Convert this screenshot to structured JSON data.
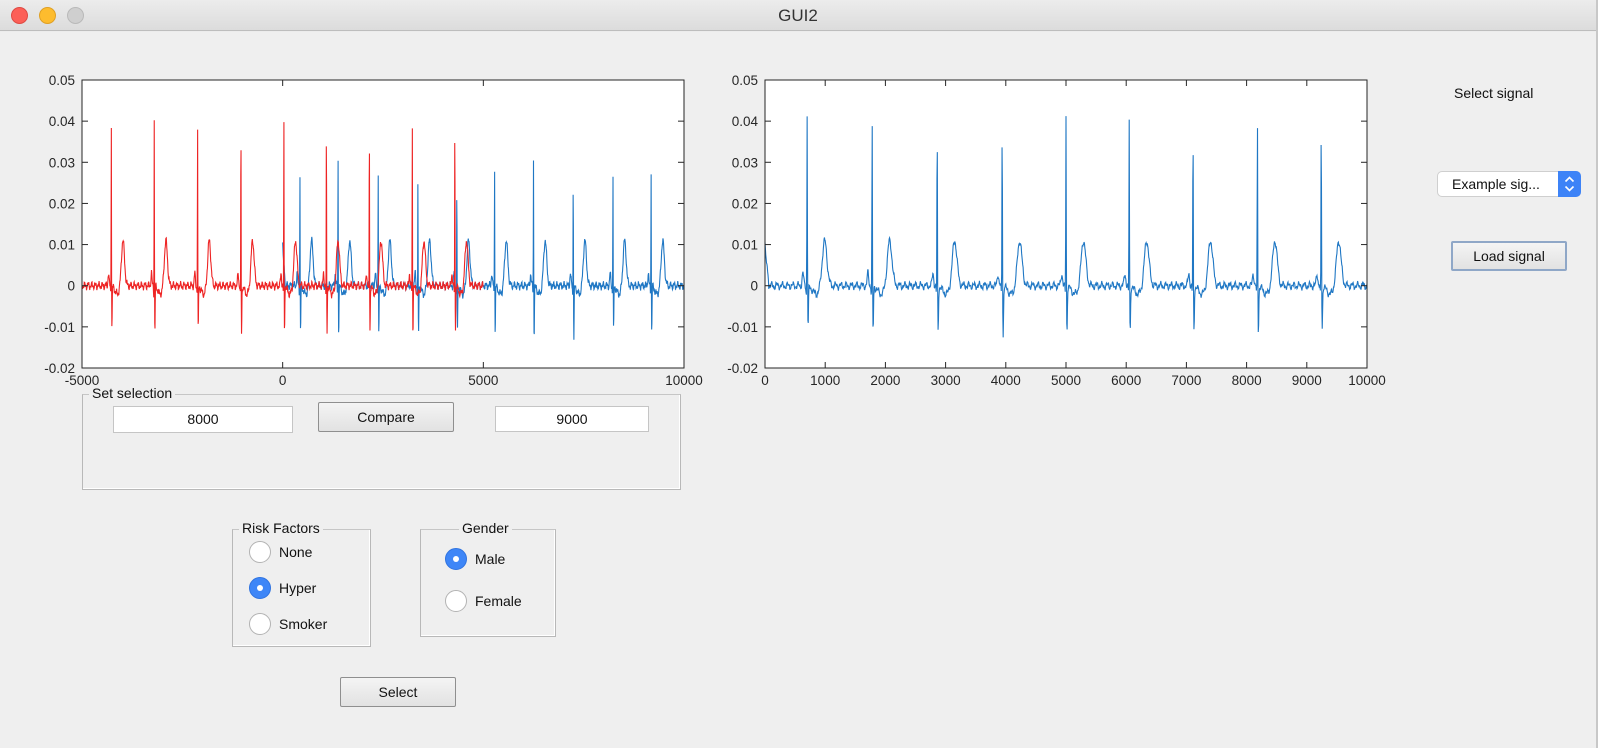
{
  "window": {
    "title": "GUI2"
  },
  "colors": {
    "overlay_series": "#ee2424",
    "signal_series": "#1f77c4",
    "radio_selected": "#3e86f7"
  },
  "select_signal_label": "Select signal",
  "signal_dropdown": {
    "value": "Example sig..."
  },
  "load_button_label": "Load signal",
  "selection_panel": {
    "title": "Set selection",
    "start_value": "8000",
    "end_value": "9000",
    "compare_label": "Compare"
  },
  "risk_factors": {
    "title": "Risk Factors",
    "options": [
      "None",
      "Hyper",
      "Smoker"
    ],
    "selected": "Hyper"
  },
  "gender": {
    "title": "Gender",
    "options": [
      "Male",
      "Female"
    ],
    "selected": "Male"
  },
  "select_button_label": "Select",
  "chart_data": [
    {
      "type": "line",
      "title": "",
      "xlabel": "",
      "ylabel": "",
      "xlim": [
        -5000,
        10000
      ],
      "ylim": [
        -0.02,
        0.05
      ],
      "xticks": [
        "-5000",
        "0",
        "5000",
        "10000"
      ],
      "yticks": [
        "-0.02",
        "-0.01",
        "0",
        "0.01",
        "0.02",
        "0.03",
        "0.04",
        "0.05"
      ],
      "grid": false,
      "series": [
        {
          "color": "#1f77c4",
          "x_range": [
            0,
            10000
          ],
          "beats": [
            {
              "r_peak_x": 430,
              "r_peak_y": 0.029,
              "s_y": -0.011
            },
            {
              "r_peak_x": 1380,
              "r_peak_y": 0.033,
              "s_y": -0.011
            },
            {
              "r_peak_x": 2380,
              "r_peak_y": 0.03,
              "s_y": -0.012
            },
            {
              "r_peak_x": 3370,
              "r_peak_y": 0.026,
              "s_y": -0.012
            },
            {
              "r_peak_x": 4340,
              "r_peak_y": 0.026,
              "s_y": -0.011
            },
            {
              "r_peak_x": 5280,
              "r_peak_y": 0.031,
              "s_y": -0.011
            },
            {
              "r_peak_x": 6250,
              "r_peak_y": 0.031,
              "s_y": -0.012
            },
            {
              "r_peak_x": 7240,
              "r_peak_y": 0.028,
              "s_y": -0.013
            },
            {
              "r_peak_x": 8230,
              "r_peak_y": 0.029,
              "s_y": -0.011
            },
            {
              "r_peak_x": 9180,
              "r_peak_y": 0.03,
              "s_y": -0.011
            }
          ]
        },
        {
          "color": "#ee2424",
          "x_range": [
            -5000,
            5000
          ],
          "beats": [
            {
              "r_peak_x": -4270,
              "r_peak_y": 0.042,
              "s_y": -0.01
            },
            {
              "r_peak_x": -3200,
              "r_peak_y": 0.041,
              "s_y": -0.011
            },
            {
              "r_peak_x": -2120,
              "r_peak_y": 0.041,
              "s_y": -0.011
            },
            {
              "r_peak_x": -1040,
              "r_peak_y": 0.042,
              "s_y": -0.012
            },
            {
              "r_peak_x": 30,
              "r_peak_y": 0.042,
              "s_y": -0.011
            },
            {
              "r_peak_x": 1090,
              "r_peak_y": 0.041,
              "s_y": -0.011
            },
            {
              "r_peak_x": 2160,
              "r_peak_y": 0.041,
              "s_y": -0.011
            },
            {
              "r_peak_x": 3230,
              "r_peak_y": 0.041,
              "s_y": -0.011
            },
            {
              "r_peak_x": 4290,
              "r_peak_y": 0.042,
              "s_y": -0.01
            }
          ]
        }
      ]
    },
    {
      "type": "line",
      "title": "",
      "xlabel": "",
      "ylabel": "",
      "xlim": [
        0,
        10000
      ],
      "ylim": [
        -0.02,
        0.05
      ],
      "xticks": [
        "0",
        "1000",
        "2000",
        "3000",
        "4000",
        "5000",
        "6000",
        "7000",
        "8000",
        "9000",
        "10000"
      ],
      "yticks": [
        "-0.02",
        "-0.01",
        "0",
        "0.01",
        "0.02",
        "0.03",
        "0.04",
        "0.05"
      ],
      "grid": false,
      "series": [
        {
          "color": "#1f77c4",
          "x_range": [
            0,
            10000
          ],
          "beats": [
            {
              "r_peak_x": 700,
              "r_peak_y": 0.042,
              "s_y": -0.01
            },
            {
              "r_peak_x": 1780,
              "r_peak_y": 0.041,
              "s_y": -0.011
            },
            {
              "r_peak_x": 2860,
              "r_peak_y": 0.041,
              "s_y": -0.011
            },
            {
              "r_peak_x": 3940,
              "r_peak_y": 0.042,
              "s_y": -0.012
            },
            {
              "r_peak_x": 5000,
              "r_peak_y": 0.042,
              "s_y": -0.011
            },
            {
              "r_peak_x": 6050,
              "r_peak_y": 0.041,
              "s_y": -0.011
            },
            {
              "r_peak_x": 7110,
              "r_peak_y": 0.04,
              "s_y": -0.011
            },
            {
              "r_peak_x": 8180,
              "r_peak_y": 0.041,
              "s_y": -0.011
            },
            {
              "r_peak_x": 9240,
              "r_peak_y": 0.042,
              "s_y": -0.01
            }
          ]
        }
      ]
    }
  ]
}
